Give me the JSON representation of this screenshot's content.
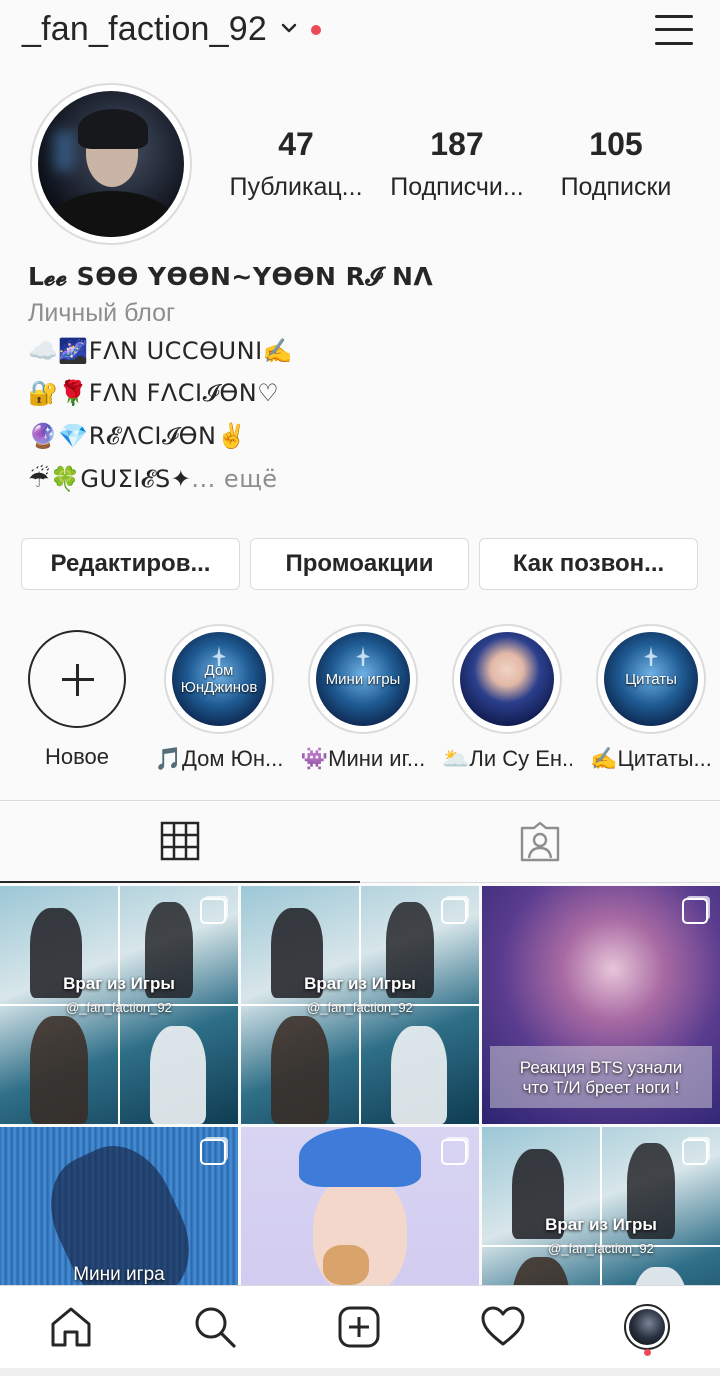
{
  "header": {
    "username": "_fan_faction_92"
  },
  "profile": {
    "stats": [
      {
        "value": "47",
        "label": "Публикац..."
      },
      {
        "value": "187",
        "label": "Подписчи..."
      },
      {
        "value": "105",
        "label": "Подписки"
      }
    ],
    "full_name": "L𝓮𝓮 SӨӨ YӨӨN~YӨӨN R𝓘 NΛ",
    "category": "Личный блог",
    "bio": [
      "☁️🌌FΛN UCCӨUNI✍️",
      "🔐🌹FΛN FΛCI𝓘ӨN♡",
      "🔮💎R𝓔ΛCI𝓘ӨN✌️",
      "☔🍀GUΣI𝓔S✦"
    ],
    "bio_more": "... ещё"
  },
  "buttons": {
    "edit": "Редактиров...",
    "promo": "Промоакции",
    "contact": "Как позвон..."
  },
  "highlights": [
    {
      "label": "Новое",
      "cover_text": ""
    },
    {
      "label": "🎵Дом Юн...",
      "cover_text": "Дом ЮнДжинов"
    },
    {
      "label": "👾Мини иг...",
      "cover_text": "Мини игры"
    },
    {
      "label": "🌥️Ли Су Ен...",
      "cover_text": ""
    },
    {
      "label": "✍️Цитаты...",
      "cover_text": "Цитаты"
    }
  ],
  "posts": [
    {
      "title": "Враг из Игры",
      "handle": "@_fan_faction_92"
    },
    {
      "title": "Враг из Игры",
      "handle": "@_fan_faction_92"
    },
    {
      "title": "Реакция BTS узнали что Т/И бреет ноги !",
      "handle": ""
    },
    {
      "title": "Мини игра",
      "handle": ""
    },
    {
      "title": "",
      "handle": ""
    },
    {
      "title": "Враг из Игры",
      "handle": "@_fan_faction_92"
    }
  ],
  "colors": {
    "notification_dot": "#ed4956",
    "text": "#262626",
    "secondary_text": "#8e8e8e",
    "border": "#dbdbdb"
  }
}
